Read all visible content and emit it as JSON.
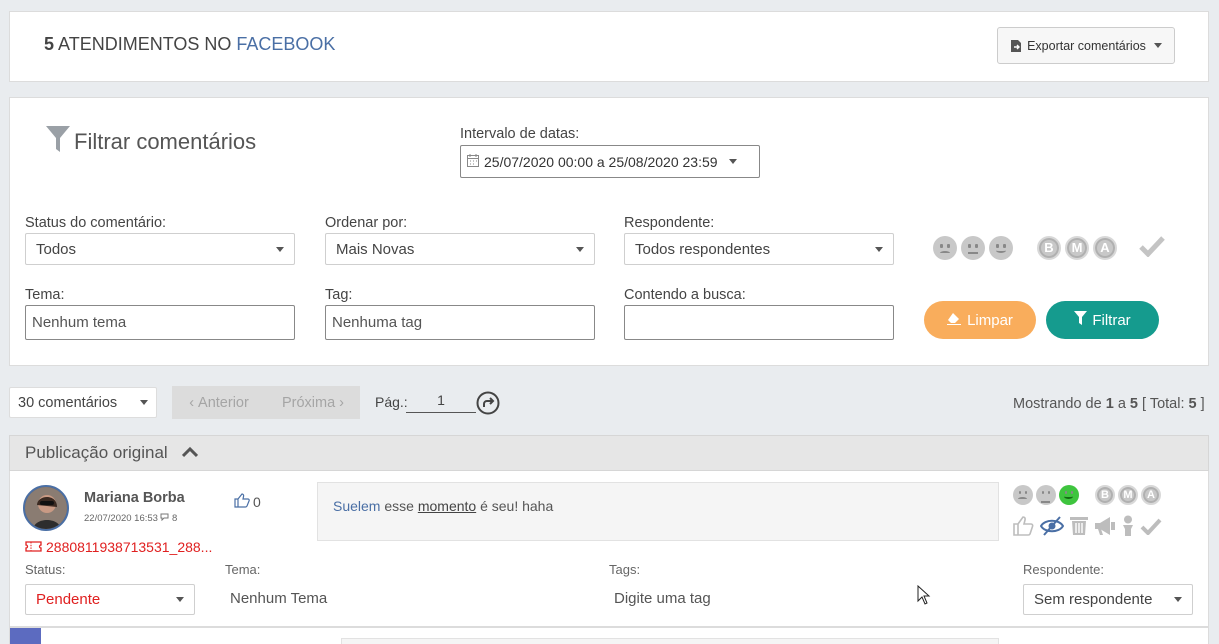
{
  "header": {
    "count": "5",
    "title_text": "ATENDIMENTOS NO",
    "network": "FACEBOOK",
    "export_label": "Exportar comentários"
  },
  "filter": {
    "title": "Filtrar comentários",
    "date_label": "Intervalo de datas:",
    "date_value": "25/07/2020 00:00 a 25/08/2020 23:59",
    "status_label": "Status do comentário:",
    "status_value": "Todos",
    "order_label": "Ordenar por:",
    "order_value": "Mais Novas",
    "respondent_label": "Respondente:",
    "respondent_value": "Todos respondentes",
    "theme_label": "Tema:",
    "theme_placeholder": "Nenhum tema",
    "tag_label": "Tag:",
    "tag_placeholder": "Nenhuma tag",
    "search_label": "Contendo a busca:",
    "search_value": "",
    "letters": [
      "B",
      "M",
      "A"
    ],
    "clear_label": "Limpar",
    "filter_label": "Filtrar",
    "colors": {
      "clear": "#f9ad5c",
      "filter": "#159b8e"
    }
  },
  "pagination": {
    "per_page": "30 comentários",
    "prev": "Anterior",
    "next": "Próxima",
    "page_label": "Pág.:",
    "page_value": "1",
    "showing_prefix": "Mostrando de",
    "from": "1",
    "to_word": "a",
    "to": "5",
    "total_prefix": "[ Total:",
    "total": "5",
    "total_suffix": "]"
  },
  "post": {
    "section_title": "Publicação original",
    "comment": {
      "author": "Mariana Borba",
      "date": "22/07/2020 16:53",
      "replies": "8",
      "likes": "0",
      "ticket": "2880811938713531_288...",
      "mention": "Suelem",
      "text_middle": " esse ",
      "link_word": "momento",
      "text_end": " é seu! haha",
      "letters": [
        "B",
        "M",
        "A"
      ],
      "status_label": "Status:",
      "status_value": "Pendente",
      "theme_label": "Tema:",
      "theme_value": "Nenhum Tema",
      "tags_label": "Tags:",
      "tags_placeholder": "Digite uma tag",
      "respondent_label": "Respondente:",
      "respondent_value": "Sem respondente"
    }
  }
}
